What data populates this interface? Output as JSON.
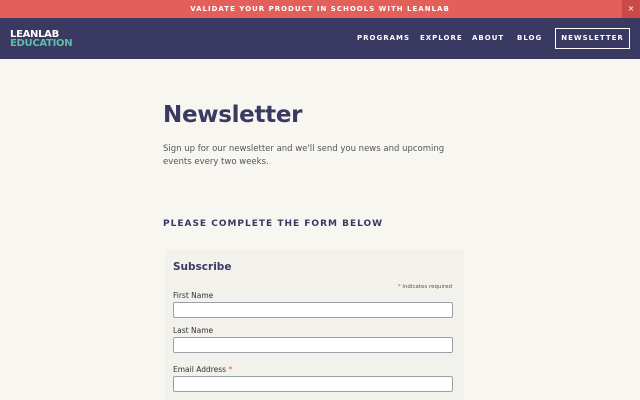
{
  "announcement": {
    "text": "VALIDATE YOUR PRODUCT IN SCHOOLS WITH LEANLAB",
    "close_label": "×"
  },
  "nav": {
    "logo_line1": "LEANLAB",
    "logo_line2": "EDUCATION",
    "items": [
      "PROGRAMS",
      "EXPLORE",
      "ABOUT",
      "BLOG"
    ],
    "cta_label": "NEWSLETTER"
  },
  "page": {
    "title": "Newsletter",
    "intro": "Sign up for our newsletter and we'll send you news and upcoming events every two weeks.",
    "form_heading": "PLEASE COMPLETE THE FORM BELOW"
  },
  "form": {
    "heading": "Subscribe",
    "required_marker": "*",
    "required_note": "indicates required",
    "fields": [
      {
        "label": "First Name",
        "required": false,
        "value": ""
      },
      {
        "label": "Last Name",
        "required": false,
        "value": ""
      },
      {
        "label": "Email Address",
        "required": true,
        "value": ""
      }
    ]
  },
  "colors": {
    "announce_bg": "#e35f5a",
    "nav_bg": "#393961",
    "accent_green": "#5bbfa6",
    "page_bg": "#f7f6f1"
  }
}
